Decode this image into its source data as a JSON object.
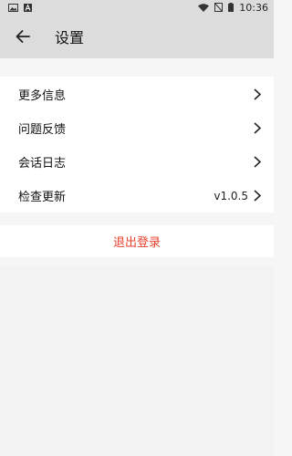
{
  "status_bar": {
    "time": "10:36",
    "icons": [
      "image-icon",
      "a-icon",
      "wifi-icon",
      "no-sim-icon",
      "battery-icon"
    ]
  },
  "app_bar": {
    "back_icon": "back-arrow-icon",
    "title": "设置"
  },
  "menu": {
    "items": [
      {
        "label": "更多信息",
        "icon": "chevron-right-icon"
      },
      {
        "label": "问题反馈",
        "icon": "chevron-right-icon"
      },
      {
        "label": "会话日志",
        "icon": "chevron-right-icon"
      },
      {
        "label": "检查更新",
        "value": "v1.0.5",
        "icon": "chevron-right-icon"
      }
    ]
  },
  "logout": {
    "label": "退出登录",
    "color": "#e8402b"
  }
}
